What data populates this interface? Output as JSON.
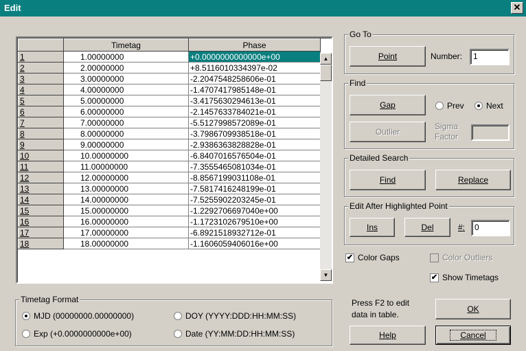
{
  "window": {
    "title": "Edit",
    "close_glyph": "✕"
  },
  "grid": {
    "columns": [
      "",
      "Timetag",
      "Phase"
    ],
    "rows": [
      {
        "n": "1",
        "t": "1.00000000",
        "p": "+0.0000000000000e+00"
      },
      {
        "n": "2",
        "t": "2.00000000",
        "p": "+8.5116010334397e-02"
      },
      {
        "n": "3",
        "t": "3.00000000",
        "p": "-2.2047548258606e-01"
      },
      {
        "n": "4",
        "t": "4.00000000",
        "p": "-1.4707417985148e-01"
      },
      {
        "n": "5",
        "t": "5.00000000",
        "p": "-3.4175630294613e-01"
      },
      {
        "n": "6",
        "t": "6.00000000",
        "p": "-2.1457633784021e-01"
      },
      {
        "n": "7",
        "t": "7.00000000",
        "p": "-5.5127998572089e-01"
      },
      {
        "n": "8",
        "t": "8.00000000",
        "p": "-3.7986709938518e-01"
      },
      {
        "n": "9",
        "t": "9.00000000",
        "p": "-2.9386363828828e-01"
      },
      {
        "n": "10",
        "t": "10.00000000",
        "p": "-6.8407016576504e-01"
      },
      {
        "n": "11",
        "t": "11.00000000",
        "p": "-7.3555465081034e-01"
      },
      {
        "n": "12",
        "t": "12.00000000",
        "p": "-8.8567199031108e-01"
      },
      {
        "n": "13",
        "t": "13.00000000",
        "p": "-7.5817416248199e-01"
      },
      {
        "n": "14",
        "t": "14.00000000",
        "p": "-7.5255902203245e-01"
      },
      {
        "n": "15",
        "t": "15.00000000",
        "p": "-1.2292706697040e+00"
      },
      {
        "n": "16",
        "t": "16.00000000",
        "p": "-1.1723102679510e+00"
      },
      {
        "n": "17",
        "t": "17.00000000",
        "p": "-6.8921518932712e-01"
      },
      {
        "n": "18",
        "t": "18.00000000",
        "p": "-1.1606059406016e+00"
      }
    ]
  },
  "goto": {
    "title": "Go To",
    "point_label": "Point",
    "number_label": "Number:",
    "number_value": "1"
  },
  "find": {
    "title": "Find",
    "gap_label": "Gap",
    "prev_label": "Prev",
    "next_label": "Next",
    "outlier_label": "Outlier",
    "sigma_line1": "Sigma",
    "sigma_line2": "Factor",
    "sigma_value": ""
  },
  "detailed": {
    "title": "Detailed Search",
    "find_label": "Find",
    "replace_label": "Replace"
  },
  "edit_after": {
    "title": "Edit After Highlighted Point",
    "ins_label": "Ins",
    "del_label": "Del",
    "count_label": "#:",
    "count_value": "0"
  },
  "options": {
    "color_gaps": "Color Gaps",
    "color_outliers": "Color Outliers",
    "show_timetags": "Show Timetags"
  },
  "format": {
    "title": "Timetag Format",
    "mjd": "MJD (00000000.00000000)",
    "doy": "DOY (YYYY:DDD:HH:MM:SS)",
    "exp": "Exp (+0.0000000000e+00)",
    "date": "Date (YY:MM:DD:HH:MM:SS)"
  },
  "help_text": {
    "line1": "Press F2 to edit",
    "line2": "data in table."
  },
  "buttons": {
    "ok": "OK",
    "help": "Help",
    "cancel": "Cancel"
  },
  "glyphs": {
    "check": "✔",
    "scroll_up": "▲",
    "scroll_down": "▼"
  }
}
